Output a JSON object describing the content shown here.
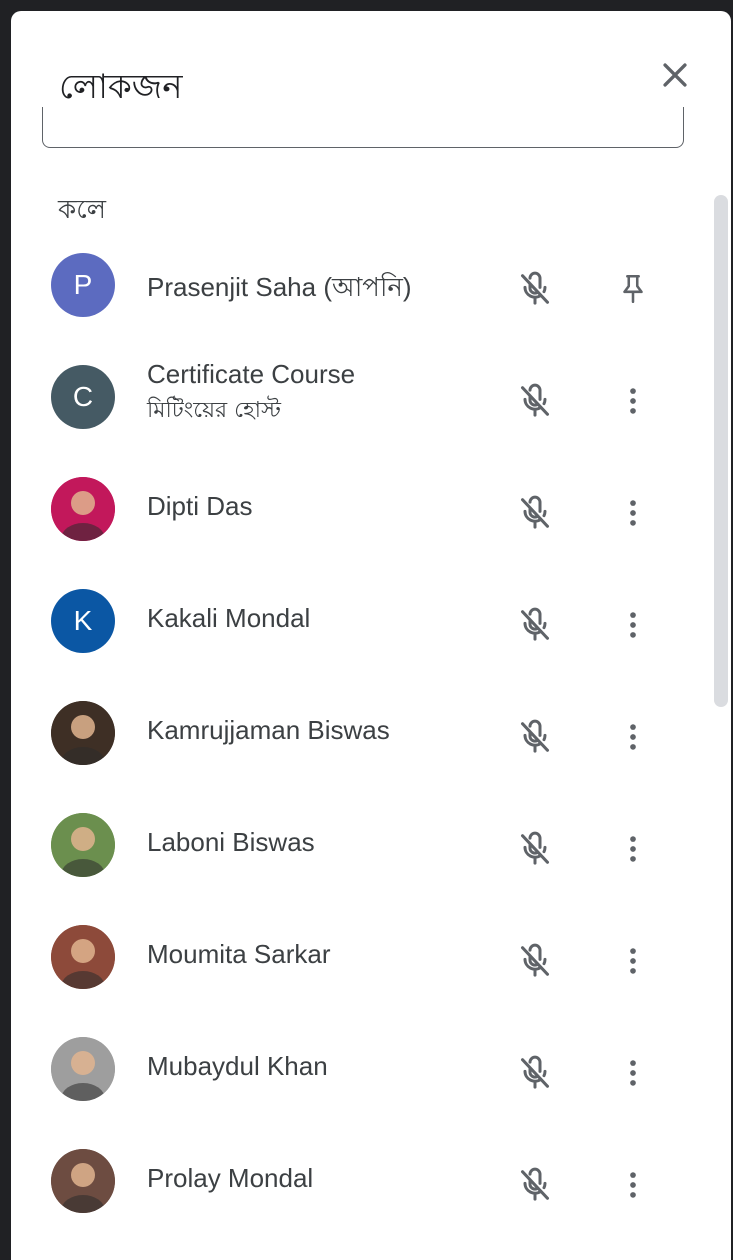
{
  "panel": {
    "title": "লোকজন",
    "section_label": "কলে"
  },
  "participants": [
    {
      "name": "Prasenjit Saha (আপনি)",
      "subtitle": "",
      "avatar_letter": "P",
      "avatar_color": "#5c6bc0",
      "avatar_type": "letter",
      "action_icon": "pin-icon"
    },
    {
      "name": "Certificate Course",
      "subtitle": "মিটিংয়ের হোস্ট",
      "avatar_letter": "C",
      "avatar_color": "#455a64",
      "avatar_type": "letter",
      "action_icon": "more-vert-icon"
    },
    {
      "name": "Dipti Das",
      "subtitle": "",
      "avatar_letter": "",
      "avatar_color": "#c2185b",
      "avatar_type": "photo",
      "action_icon": "more-vert-icon"
    },
    {
      "name": "Kakali Mondal",
      "subtitle": "",
      "avatar_letter": "K",
      "avatar_color": "#0b57a4",
      "avatar_type": "letter",
      "action_icon": "more-vert-icon"
    },
    {
      "name": "Kamrujjaman Biswas",
      "subtitle": "",
      "avatar_letter": "",
      "avatar_color": "#3e2f25",
      "avatar_type": "photo",
      "action_icon": "more-vert-icon"
    },
    {
      "name": "Laboni Biswas",
      "subtitle": "",
      "avatar_letter": "",
      "avatar_color": "#6b8f4e",
      "avatar_type": "photo",
      "action_icon": "more-vert-icon"
    },
    {
      "name": "Moumita Sarkar",
      "subtitle": "",
      "avatar_letter": "",
      "avatar_color": "#8d4a3a",
      "avatar_type": "photo",
      "action_icon": "more-vert-icon"
    },
    {
      "name": "Mubaydul Khan",
      "subtitle": "",
      "avatar_letter": "",
      "avatar_color": "#9e9e9e",
      "avatar_type": "photo",
      "action_icon": "more-vert-icon"
    },
    {
      "name": "Prolay Mondal",
      "subtitle": "",
      "avatar_letter": "",
      "avatar_color": "#6d4c41",
      "avatar_type": "photo",
      "action_icon": "more-vert-icon"
    }
  ]
}
